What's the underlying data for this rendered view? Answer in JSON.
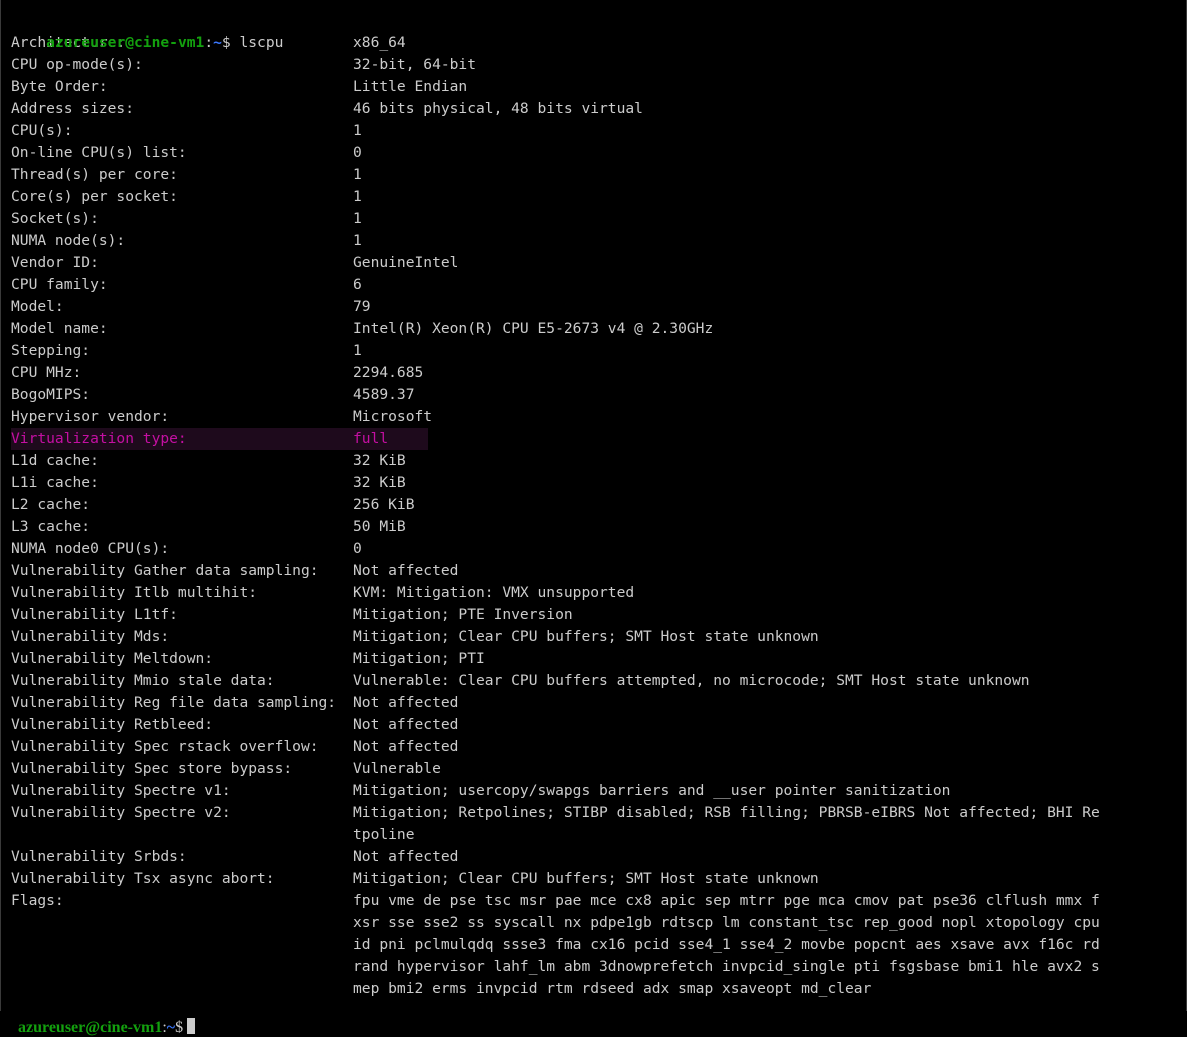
{
  "prompt": {
    "user": "azureuser@cine-vm1",
    "sep": ":",
    "path": "~",
    "dollar": "$ ",
    "command": "lscpu"
  },
  "rows": [
    {
      "key": "Architecture:",
      "value": "x86_64"
    },
    {
      "key": "CPU op-mode(s):",
      "value": "32-bit, 64-bit"
    },
    {
      "key": "Byte Order:",
      "value": "Little Endian"
    },
    {
      "key": "Address sizes:",
      "value": "46 bits physical, 48 bits virtual"
    },
    {
      "key": "CPU(s):",
      "value": "1"
    },
    {
      "key": "On-line CPU(s) list:",
      "value": "0"
    },
    {
      "key": "Thread(s) per core:",
      "value": "1"
    },
    {
      "key": "Core(s) per socket:",
      "value": "1"
    },
    {
      "key": "Socket(s):",
      "value": "1"
    },
    {
      "key": "NUMA node(s):",
      "value": "1"
    },
    {
      "key": "Vendor ID:",
      "value": "GenuineIntel"
    },
    {
      "key": "CPU family:",
      "value": "6"
    },
    {
      "key": "Model:",
      "value": "79"
    },
    {
      "key": "Model name:",
      "value": "Intel(R) Xeon(R) CPU E5-2673 v4 @ 2.30GHz"
    },
    {
      "key": "Stepping:",
      "value": "1"
    },
    {
      "key": "CPU MHz:",
      "value": "2294.685"
    },
    {
      "key": "BogoMIPS:",
      "value": "4589.37"
    },
    {
      "key": "Hypervisor vendor:",
      "value": "Microsoft"
    },
    {
      "key": "Virtualization type:",
      "value": "full"
    },
    {
      "key": "L1d cache:",
      "value": "32 KiB"
    },
    {
      "key": "L1i cache:",
      "value": "32 KiB"
    },
    {
      "key": "L2 cache:",
      "value": "256 KiB"
    },
    {
      "key": "L3 cache:",
      "value": "50 MiB"
    },
    {
      "key": "NUMA node0 CPU(s):",
      "value": "0"
    },
    {
      "key": "Vulnerability Gather data sampling:",
      "value": "Not affected"
    },
    {
      "key": "Vulnerability Itlb multihit:",
      "value": "KVM: Mitigation: VMX unsupported"
    },
    {
      "key": "Vulnerability L1tf:",
      "value": "Mitigation; PTE Inversion"
    },
    {
      "key": "Vulnerability Mds:",
      "value": "Mitigation; Clear CPU buffers; SMT Host state unknown"
    },
    {
      "key": "Vulnerability Meltdown:",
      "value": "Mitigation; PTI"
    },
    {
      "key": "Vulnerability Mmio stale data:",
      "value": "Vulnerable: Clear CPU buffers attempted, no microcode; SMT Host state unknown"
    },
    {
      "key": "Vulnerability Reg file data sampling:",
      "value": "Not affected"
    },
    {
      "key": "Vulnerability Retbleed:",
      "value": "Not affected"
    },
    {
      "key": "Vulnerability Spec rstack overflow:",
      "value": "Not affected"
    },
    {
      "key": "Vulnerability Spec store bypass:",
      "value": "Vulnerable"
    },
    {
      "key": "Vulnerability Spectre v1:",
      "value": "Mitigation; usercopy/swapgs barriers and __user pointer sanitization"
    },
    {
      "key": "Vulnerability Spectre v2:",
      "value": "Mitigation; Retpolines; STIBP disabled; RSB filling; PBRSB-eIBRS Not affected; BHI Re\ntpoline"
    },
    {
      "key": "Vulnerability Srbds:",
      "value": "Not affected"
    },
    {
      "key": "Vulnerability Tsx async abort:",
      "value": "Mitigation; Clear CPU buffers; SMT Host state unknown"
    },
    {
      "key": "Flags:",
      "value": "fpu vme de pse tsc msr pae mce cx8 apic sep mtrr pge mca cmov pat pse36 clflush mmx f\nxsr sse sse2 ss syscall nx pdpe1gb rdtscp lm constant_tsc rep_good nopl xtopology cpu\nid pni pclmulqdq ssse3 fma cx16 pcid sse4_1 sse4_2 movbe popcnt aes xsave avx f16c rd\nrand hypervisor lahf_lm abm 3dnowprefetch invpcid_single pti fsgsbase bmi1 hle avx2 s\nmep bmi2 erms invpcid rtm rdseed adx smap xsaveopt md_clear"
    }
  ],
  "highlighted_row_key": "Virtualization type:",
  "colors": {
    "background": "#000000",
    "text": "#cccccc",
    "prompt_user": "#13a10e",
    "prompt_path": "#3b78ff",
    "highlight_text": "#c40fa2",
    "highlight_bg": "#1e0a1c"
  }
}
